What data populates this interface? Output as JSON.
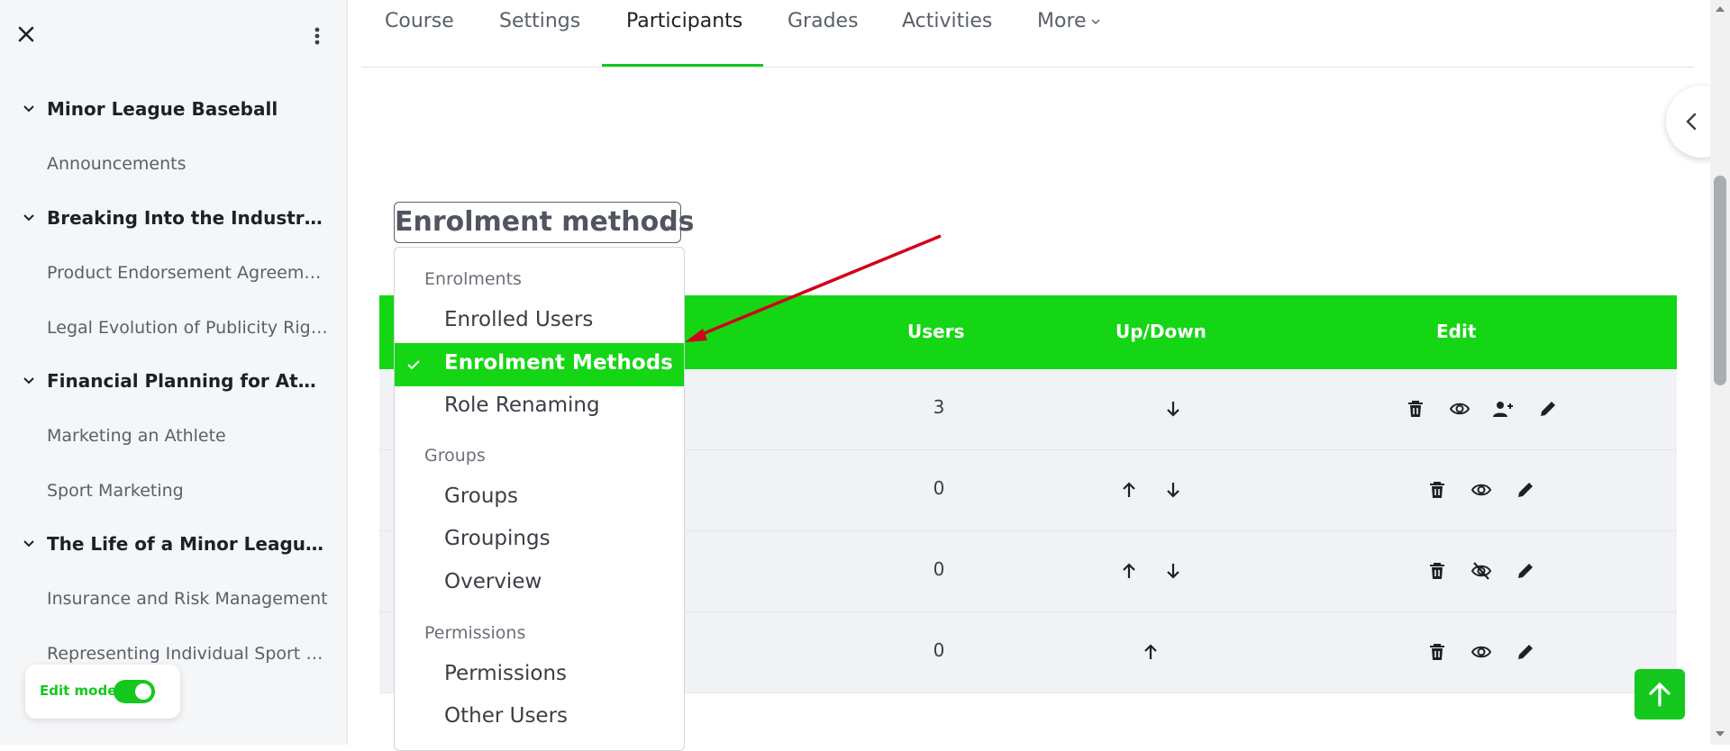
{
  "sidebar": {
    "items": [
      {
        "type": "section",
        "label": "Minor League Baseball"
      },
      {
        "type": "link",
        "label": "Announcements"
      },
      {
        "type": "section",
        "label": "Breaking Into the Industry and Understanding Athlete Representation"
      },
      {
        "type": "link",
        "label": "Product Endorsement Agreements"
      },
      {
        "type": "link",
        "label": "Legal Evolution of Publicity Rights"
      },
      {
        "type": "section",
        "label": "Financial Planning for Athletes and Their Families"
      },
      {
        "type": "link",
        "label": "Marketing an Athlete"
      },
      {
        "type": "link",
        "label": "Sport Marketing"
      },
      {
        "type": "section",
        "label": "The Life of a Minor League Baseball Player"
      },
      {
        "type": "link",
        "label": "Insurance and Risk Management"
      },
      {
        "type": "link",
        "label": "Representing Individual Sport Athletes"
      }
    ],
    "edit_mode_label": "Edit mode",
    "edit_mode_on": true
  },
  "nav": {
    "tabs": [
      "Course",
      "Settings",
      "Participants",
      "Grades",
      "Activities",
      "More"
    ],
    "active": "Participants"
  },
  "select": {
    "current": "Enrolment methods",
    "menu": [
      {
        "group": "Enrolments",
        "options": [
          "Enrolled Users",
          "Enrolment Methods",
          "Role Renaming"
        ]
      },
      {
        "group": "Groups",
        "options": [
          "Groups",
          "Groupings",
          "Overview"
        ]
      },
      {
        "group": "Permissions",
        "options": [
          "Permissions",
          "Other Users"
        ]
      }
    ],
    "selected": "Enrolment Methods"
  },
  "table": {
    "headers": {
      "users": "Users",
      "updown": "Up/Down",
      "edit": "Edit"
    },
    "rows": [
      {
        "users": "3",
        "updown": [
          "down"
        ],
        "edit": [
          "delete",
          "visible",
          "enrol-user",
          "edit"
        ]
      },
      {
        "users": "0",
        "updown": [
          "up",
          "down"
        ],
        "edit": [
          "delete",
          "visible",
          "edit"
        ]
      },
      {
        "users": "0",
        "updown": [
          "up",
          "down"
        ],
        "edit": [
          "delete",
          "hidden",
          "edit"
        ]
      },
      {
        "users": "0",
        "updown": [
          "up"
        ],
        "edit": [
          "delete",
          "visible",
          "edit"
        ]
      }
    ]
  },
  "colors": {
    "accent": "#14d614",
    "annotation": "#d0021b",
    "sidebar_bg": "#f5f6f8"
  },
  "icons": {
    "back_to_top": "arrow-up-icon",
    "drawer": "chevron-left-icon"
  }
}
